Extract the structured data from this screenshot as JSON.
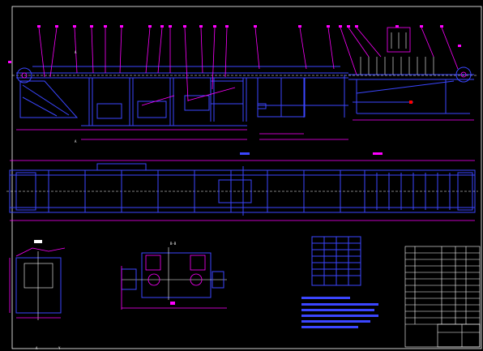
{
  "drawing": {
    "section_mark": "B-B",
    "view_mark": "A",
    "title_block_heading": "—",
    "corner_marks": [
      "A",
      "Y"
    ]
  },
  "leaders": {
    "count_top": 24
  },
  "colors": {
    "background": "#000000",
    "frame": "#3b46ff",
    "dimensions": "#ff00ff",
    "centerlines": "#ffffff",
    "callouts": "#ff00ff",
    "accent_green": "#00ff00",
    "accent_red": "#ff0000"
  }
}
